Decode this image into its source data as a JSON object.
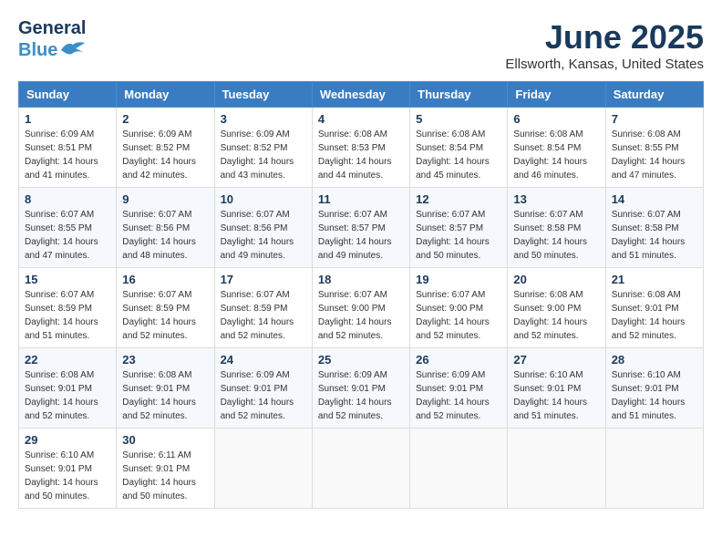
{
  "header": {
    "logo_line1": "General",
    "logo_line2": "Blue",
    "month": "June 2025",
    "location": "Ellsworth, Kansas, United States"
  },
  "weekdays": [
    "Sunday",
    "Monday",
    "Tuesday",
    "Wednesday",
    "Thursday",
    "Friday",
    "Saturday"
  ],
  "weeks": [
    [
      {
        "day": "1",
        "sunrise": "6:09 AM",
        "sunset": "8:51 PM",
        "daylight": "14 hours and 41 minutes."
      },
      {
        "day": "2",
        "sunrise": "6:09 AM",
        "sunset": "8:52 PM",
        "daylight": "14 hours and 42 minutes."
      },
      {
        "day": "3",
        "sunrise": "6:09 AM",
        "sunset": "8:52 PM",
        "daylight": "14 hours and 43 minutes."
      },
      {
        "day": "4",
        "sunrise": "6:08 AM",
        "sunset": "8:53 PM",
        "daylight": "14 hours and 44 minutes."
      },
      {
        "day": "5",
        "sunrise": "6:08 AM",
        "sunset": "8:54 PM",
        "daylight": "14 hours and 45 minutes."
      },
      {
        "day": "6",
        "sunrise": "6:08 AM",
        "sunset": "8:54 PM",
        "daylight": "14 hours and 46 minutes."
      },
      {
        "day": "7",
        "sunrise": "6:08 AM",
        "sunset": "8:55 PM",
        "daylight": "14 hours and 47 minutes."
      }
    ],
    [
      {
        "day": "8",
        "sunrise": "6:07 AM",
        "sunset": "8:55 PM",
        "daylight": "14 hours and 47 minutes."
      },
      {
        "day": "9",
        "sunrise": "6:07 AM",
        "sunset": "8:56 PM",
        "daylight": "14 hours and 48 minutes."
      },
      {
        "day": "10",
        "sunrise": "6:07 AM",
        "sunset": "8:56 PM",
        "daylight": "14 hours and 49 minutes."
      },
      {
        "day": "11",
        "sunrise": "6:07 AM",
        "sunset": "8:57 PM",
        "daylight": "14 hours and 49 minutes."
      },
      {
        "day": "12",
        "sunrise": "6:07 AM",
        "sunset": "8:57 PM",
        "daylight": "14 hours and 50 minutes."
      },
      {
        "day": "13",
        "sunrise": "6:07 AM",
        "sunset": "8:58 PM",
        "daylight": "14 hours and 50 minutes."
      },
      {
        "day": "14",
        "sunrise": "6:07 AM",
        "sunset": "8:58 PM",
        "daylight": "14 hours and 51 minutes."
      }
    ],
    [
      {
        "day": "15",
        "sunrise": "6:07 AM",
        "sunset": "8:59 PM",
        "daylight": "14 hours and 51 minutes."
      },
      {
        "day": "16",
        "sunrise": "6:07 AM",
        "sunset": "8:59 PM",
        "daylight": "14 hours and 52 minutes."
      },
      {
        "day": "17",
        "sunrise": "6:07 AM",
        "sunset": "8:59 PM",
        "daylight": "14 hours and 52 minutes."
      },
      {
        "day": "18",
        "sunrise": "6:07 AM",
        "sunset": "9:00 PM",
        "daylight": "14 hours and 52 minutes."
      },
      {
        "day": "19",
        "sunrise": "6:07 AM",
        "sunset": "9:00 PM",
        "daylight": "14 hours and 52 minutes."
      },
      {
        "day": "20",
        "sunrise": "6:08 AM",
        "sunset": "9:00 PM",
        "daylight": "14 hours and 52 minutes."
      },
      {
        "day": "21",
        "sunrise": "6:08 AM",
        "sunset": "9:01 PM",
        "daylight": "14 hours and 52 minutes."
      }
    ],
    [
      {
        "day": "22",
        "sunrise": "6:08 AM",
        "sunset": "9:01 PM",
        "daylight": "14 hours and 52 minutes."
      },
      {
        "day": "23",
        "sunrise": "6:08 AM",
        "sunset": "9:01 PM",
        "daylight": "14 hours and 52 minutes."
      },
      {
        "day": "24",
        "sunrise": "6:09 AM",
        "sunset": "9:01 PM",
        "daylight": "14 hours and 52 minutes."
      },
      {
        "day": "25",
        "sunrise": "6:09 AM",
        "sunset": "9:01 PM",
        "daylight": "14 hours and 52 minutes."
      },
      {
        "day": "26",
        "sunrise": "6:09 AM",
        "sunset": "9:01 PM",
        "daylight": "14 hours and 52 minutes."
      },
      {
        "day": "27",
        "sunrise": "6:10 AM",
        "sunset": "9:01 PM",
        "daylight": "14 hours and 51 minutes."
      },
      {
        "day": "28",
        "sunrise": "6:10 AM",
        "sunset": "9:01 PM",
        "daylight": "14 hours and 51 minutes."
      }
    ],
    [
      {
        "day": "29",
        "sunrise": "6:10 AM",
        "sunset": "9:01 PM",
        "daylight": "14 hours and 50 minutes."
      },
      {
        "day": "30",
        "sunrise": "6:11 AM",
        "sunset": "9:01 PM",
        "daylight": "14 hours and 50 minutes."
      },
      null,
      null,
      null,
      null,
      null
    ]
  ],
  "labels": {
    "sunrise": "Sunrise: ",
    "sunset": "Sunset: ",
    "daylight": "Daylight: "
  }
}
